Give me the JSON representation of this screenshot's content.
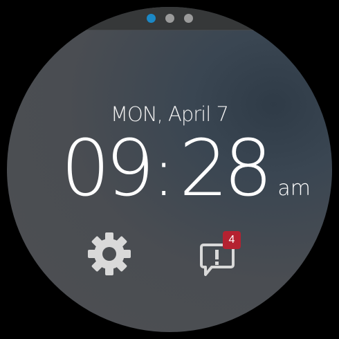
{
  "pager": {
    "pages": 3,
    "active_index": 0
  },
  "clock": {
    "date": "MON, April 7",
    "hours": "09",
    "separator": ":",
    "minutes": "28",
    "ampm": "am"
  },
  "actions": {
    "settings_icon": "gear-icon",
    "notifications_icon": "alert-bubble-icon",
    "notification_count": "4"
  },
  "colors": {
    "accent": "#1b88c6",
    "badge": "#b52231",
    "inactive_dot": "#9b9b9b",
    "icon": "#d9d9d9"
  }
}
